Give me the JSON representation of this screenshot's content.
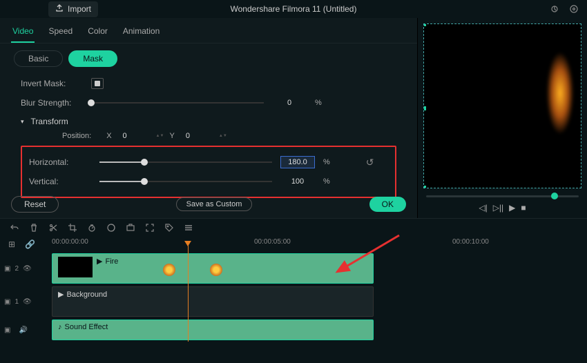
{
  "app": {
    "title": "Wondershare Filmora 11 (Untitled)"
  },
  "import": {
    "label": "Import"
  },
  "tabs": [
    {
      "id": "video",
      "label": "Video",
      "active": true
    },
    {
      "id": "speed",
      "label": "Speed",
      "active": false
    },
    {
      "id": "color",
      "label": "Color",
      "active": false
    },
    {
      "id": "animation",
      "label": "Animation",
      "active": false
    }
  ],
  "subtabs": [
    {
      "id": "basic",
      "label": "Basic",
      "active": false
    },
    {
      "id": "mask",
      "label": "Mask",
      "active": true
    }
  ],
  "mask": {
    "invert_label": "Invert Mask:",
    "blur_label": "Blur Strength:",
    "blur": {
      "value": "0",
      "unit": "%",
      "pct": 0
    },
    "transform_label": "Transform",
    "position_label": "Position:",
    "position": {
      "x_label": "X",
      "x": "0",
      "y_label": "Y",
      "y": "0"
    },
    "horizontal_label": "Horizontal:",
    "horizontal": {
      "value": "180.0",
      "unit": "%",
      "pct": 26
    },
    "vertical_label": "Vertical:",
    "vertical": {
      "value": "100",
      "unit": "%",
      "pct": 26
    }
  },
  "buttons": {
    "reset": "Reset",
    "save_custom": "Save as Custom",
    "ok": "OK"
  },
  "timeline": {
    "t0": "00:00:00:00",
    "t1": "00:00:05:00",
    "t2": "00:00:10:00",
    "tracks": [
      {
        "id": 2,
        "label": "2",
        "clip": "Fire"
      },
      {
        "id": 1,
        "label": "1",
        "clip": "Background"
      },
      {
        "id": 0,
        "label": "",
        "clip": "Sound Effect"
      }
    ]
  }
}
